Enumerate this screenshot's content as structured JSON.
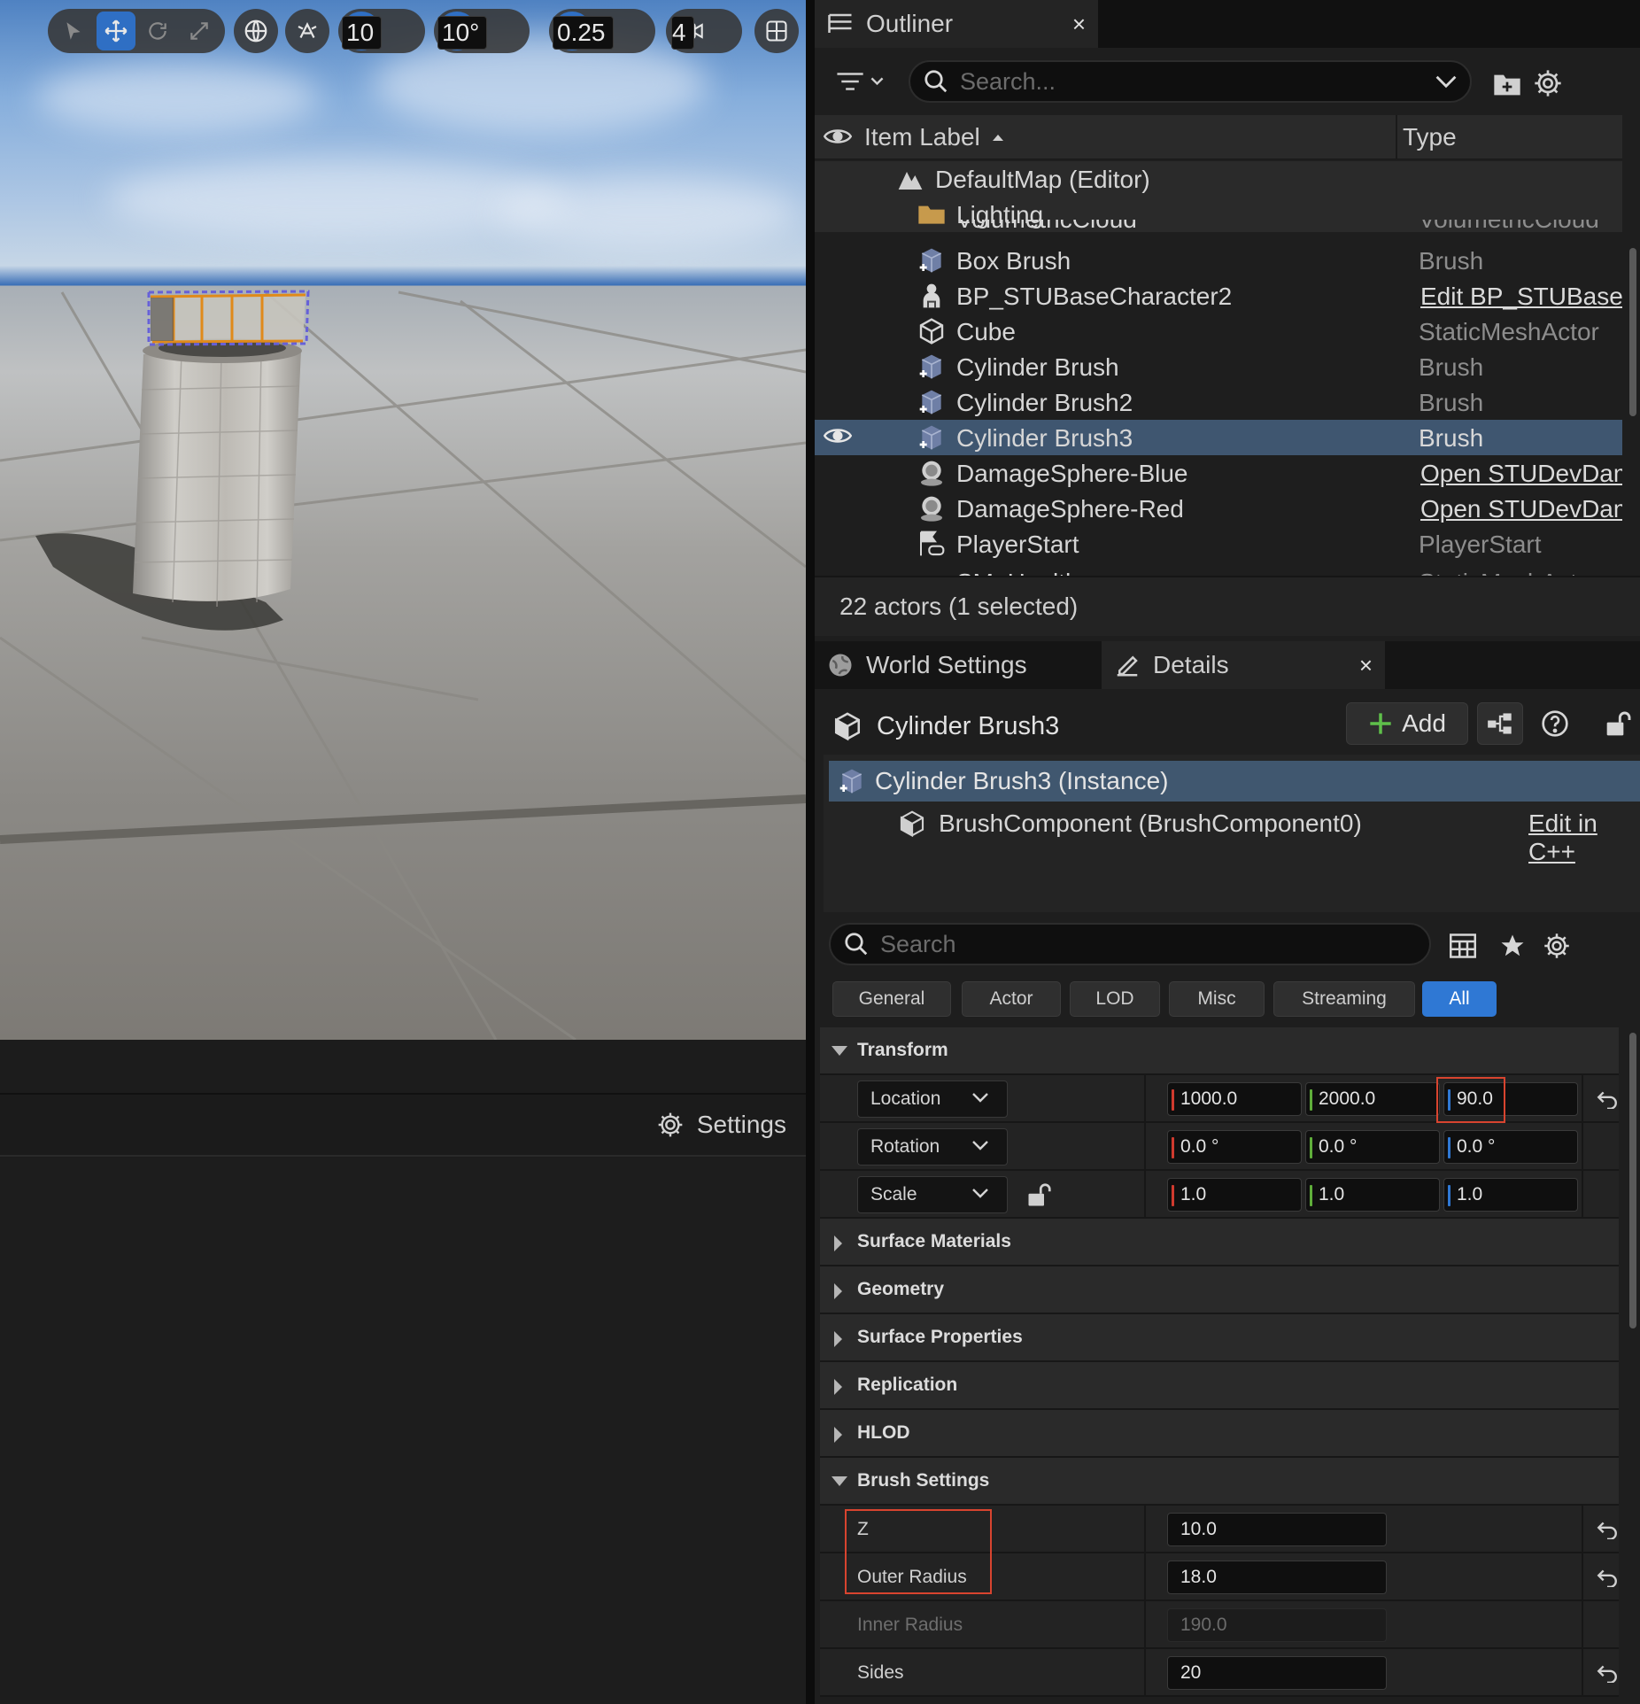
{
  "viewport": {
    "grid_snap": "10",
    "rotation_snap": "10°",
    "scale_snap": "0.25",
    "camera_speed": "4",
    "settings_label": "Settings"
  },
  "outliner": {
    "tab_title": "Outliner",
    "close": "×",
    "search_placeholder": "Search...",
    "col_label": "Item Label",
    "col_type": "Type",
    "map_row": "DefaultMap (Editor)",
    "folder_row": "Lighting",
    "cut_top_label": "VolumetricCloud",
    "cut_top_type": "VolumetricCloud",
    "rows": [
      {
        "label": "Box Brush",
        "type": "Brush",
        "link": false,
        "icon": "brush-icon"
      },
      {
        "label": "BP_STUBaseCharacter2",
        "type": "Edit BP_STUBaseC",
        "link": true,
        "icon": "character-icon"
      },
      {
        "label": "Cube",
        "type": "StaticMeshActor",
        "link": false,
        "icon": "static-mesh-icon"
      },
      {
        "label": "Cylinder Brush",
        "type": "Brush",
        "link": false,
        "icon": "brush-icon"
      },
      {
        "label": "Cylinder Brush2",
        "type": "Brush",
        "link": false,
        "icon": "brush-icon"
      },
      {
        "label": "Cylinder Brush3",
        "type": "Brush",
        "link": false,
        "icon": "brush-icon",
        "selected": true
      },
      {
        "label": "DamageSphere-Blue",
        "type": "Open STUDevDam",
        "link": true,
        "icon": "actor-icon"
      },
      {
        "label": "DamageSphere-Red",
        "type": "Open STUDevDam",
        "link": true,
        "icon": "actor-icon"
      },
      {
        "label": "PlayerStart",
        "type": "PlayerStart",
        "link": false,
        "icon": "player-start-icon"
      }
    ],
    "cut_bottom_label": "SM_Health",
    "cut_bottom_type": "StaticMeshActor",
    "status": "22 actors (1 selected)"
  },
  "details": {
    "world_settings_tab": "World Settings",
    "details_tab": "Details",
    "close": "×",
    "actor_name": "Cylinder Brush3",
    "add_label": "Add",
    "instance_label": "Cylinder Brush3 (Instance)",
    "component_label": "BrushComponent (BrushComponent0)",
    "edit_cpp": "Edit in C++",
    "search_placeholder": "Search",
    "filters": [
      "General",
      "Actor",
      "LOD",
      "Misc",
      "Streaming",
      "All"
    ],
    "active_filter": "All",
    "transform": {
      "title": "Transform",
      "location_label": "Location",
      "location": [
        "1000.0",
        "2000.0",
        "90.0"
      ],
      "rotation_label": "Rotation",
      "rotation": [
        "0.0 °",
        "0.0 °",
        "0.0 °"
      ],
      "scale_label": "Scale",
      "scale": [
        "1.0",
        "1.0",
        "1.0"
      ]
    },
    "categories": [
      "Surface Materials",
      "Geometry",
      "Surface Properties",
      "Replication",
      "HLOD"
    ],
    "brush": {
      "title": "Brush Settings",
      "z_label": "Z",
      "z_value": "10.0",
      "outer_label": "Outer Radius",
      "outer_value": "18.0",
      "inner_label": "Inner Radius",
      "inner_value": "190.0",
      "sides_label": "Sides",
      "sides_value": "20"
    }
  },
  "colors": {
    "accent": "#2f78d4",
    "selection": "#3f5670",
    "highlight_box": "#d8442f",
    "axis_x": "#d03a2e",
    "axis_y": "#5fae3a",
    "axis_z": "#2f78d4"
  }
}
